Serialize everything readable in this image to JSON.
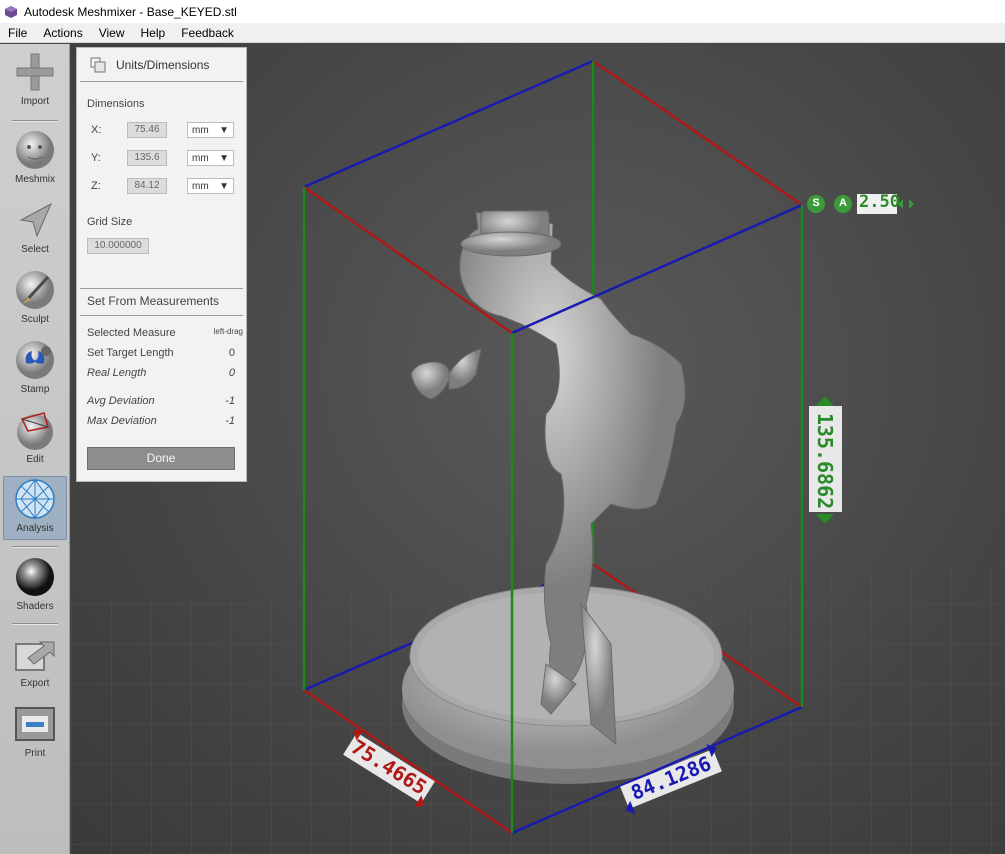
{
  "window": {
    "title": "Autodesk Meshmixer - Base_KEYED.stl"
  },
  "menu": [
    "File",
    "Actions",
    "View",
    "Help",
    "Feedback"
  ],
  "toolbar": [
    {
      "label": "Import",
      "icon": "plus-icon"
    },
    {
      "label": "Meshmix",
      "icon": "face-sphere-icon"
    },
    {
      "label": "Select",
      "icon": "arrow-cursor-icon"
    },
    {
      "label": "Sculpt",
      "icon": "brush-icon"
    },
    {
      "label": "Stamp",
      "icon": "stamp-icon"
    },
    {
      "label": "Edit",
      "icon": "edit-sphere-icon"
    },
    {
      "label": "Analysis",
      "icon": "geodesic-sphere-icon",
      "active": true
    },
    {
      "label": "Shaders",
      "icon": "chrome-sphere-icon"
    },
    {
      "label": "Export",
      "icon": "export-icon"
    },
    {
      "label": "Print",
      "icon": "printer-icon"
    }
  ],
  "panel": {
    "title": "Units/Dimensions",
    "dimensions_title": "Dimensions",
    "dims": [
      {
        "label": "X:",
        "value": "75.46",
        "unit": "mm"
      },
      {
        "label": "Y:",
        "value": "135.6",
        "unit": "mm"
      },
      {
        "label": "Z:",
        "value": "84.12",
        "unit": "mm"
      }
    ],
    "grid_title": "Grid Size",
    "grid_value": "10.000000",
    "measure_title": "Set From Measurements",
    "selected_measure": {
      "label": "Selected Measure",
      "value": "left-drag"
    },
    "target_length": {
      "label": "Set Target Length",
      "value": "0"
    },
    "real_length": {
      "label": "Real Length",
      "value": "0"
    },
    "avg_dev": {
      "label": "Avg Deviation",
      "value": "-1"
    },
    "max_dev": {
      "label": "Max Deviation",
      "value": "-1"
    },
    "done": "Done"
  },
  "viewport": {
    "snap_s": "S",
    "snap_a": "A",
    "spacing_value": "2.50",
    "dim_x": "75.4665",
    "dim_y": "135.6862",
    "dim_z": "84.1286"
  },
  "colors": {
    "box_red": "#b01818",
    "box_blue": "#1a1ab0",
    "box_green": "#1a8a1a",
    "label_bg": "#e8e8e8"
  }
}
